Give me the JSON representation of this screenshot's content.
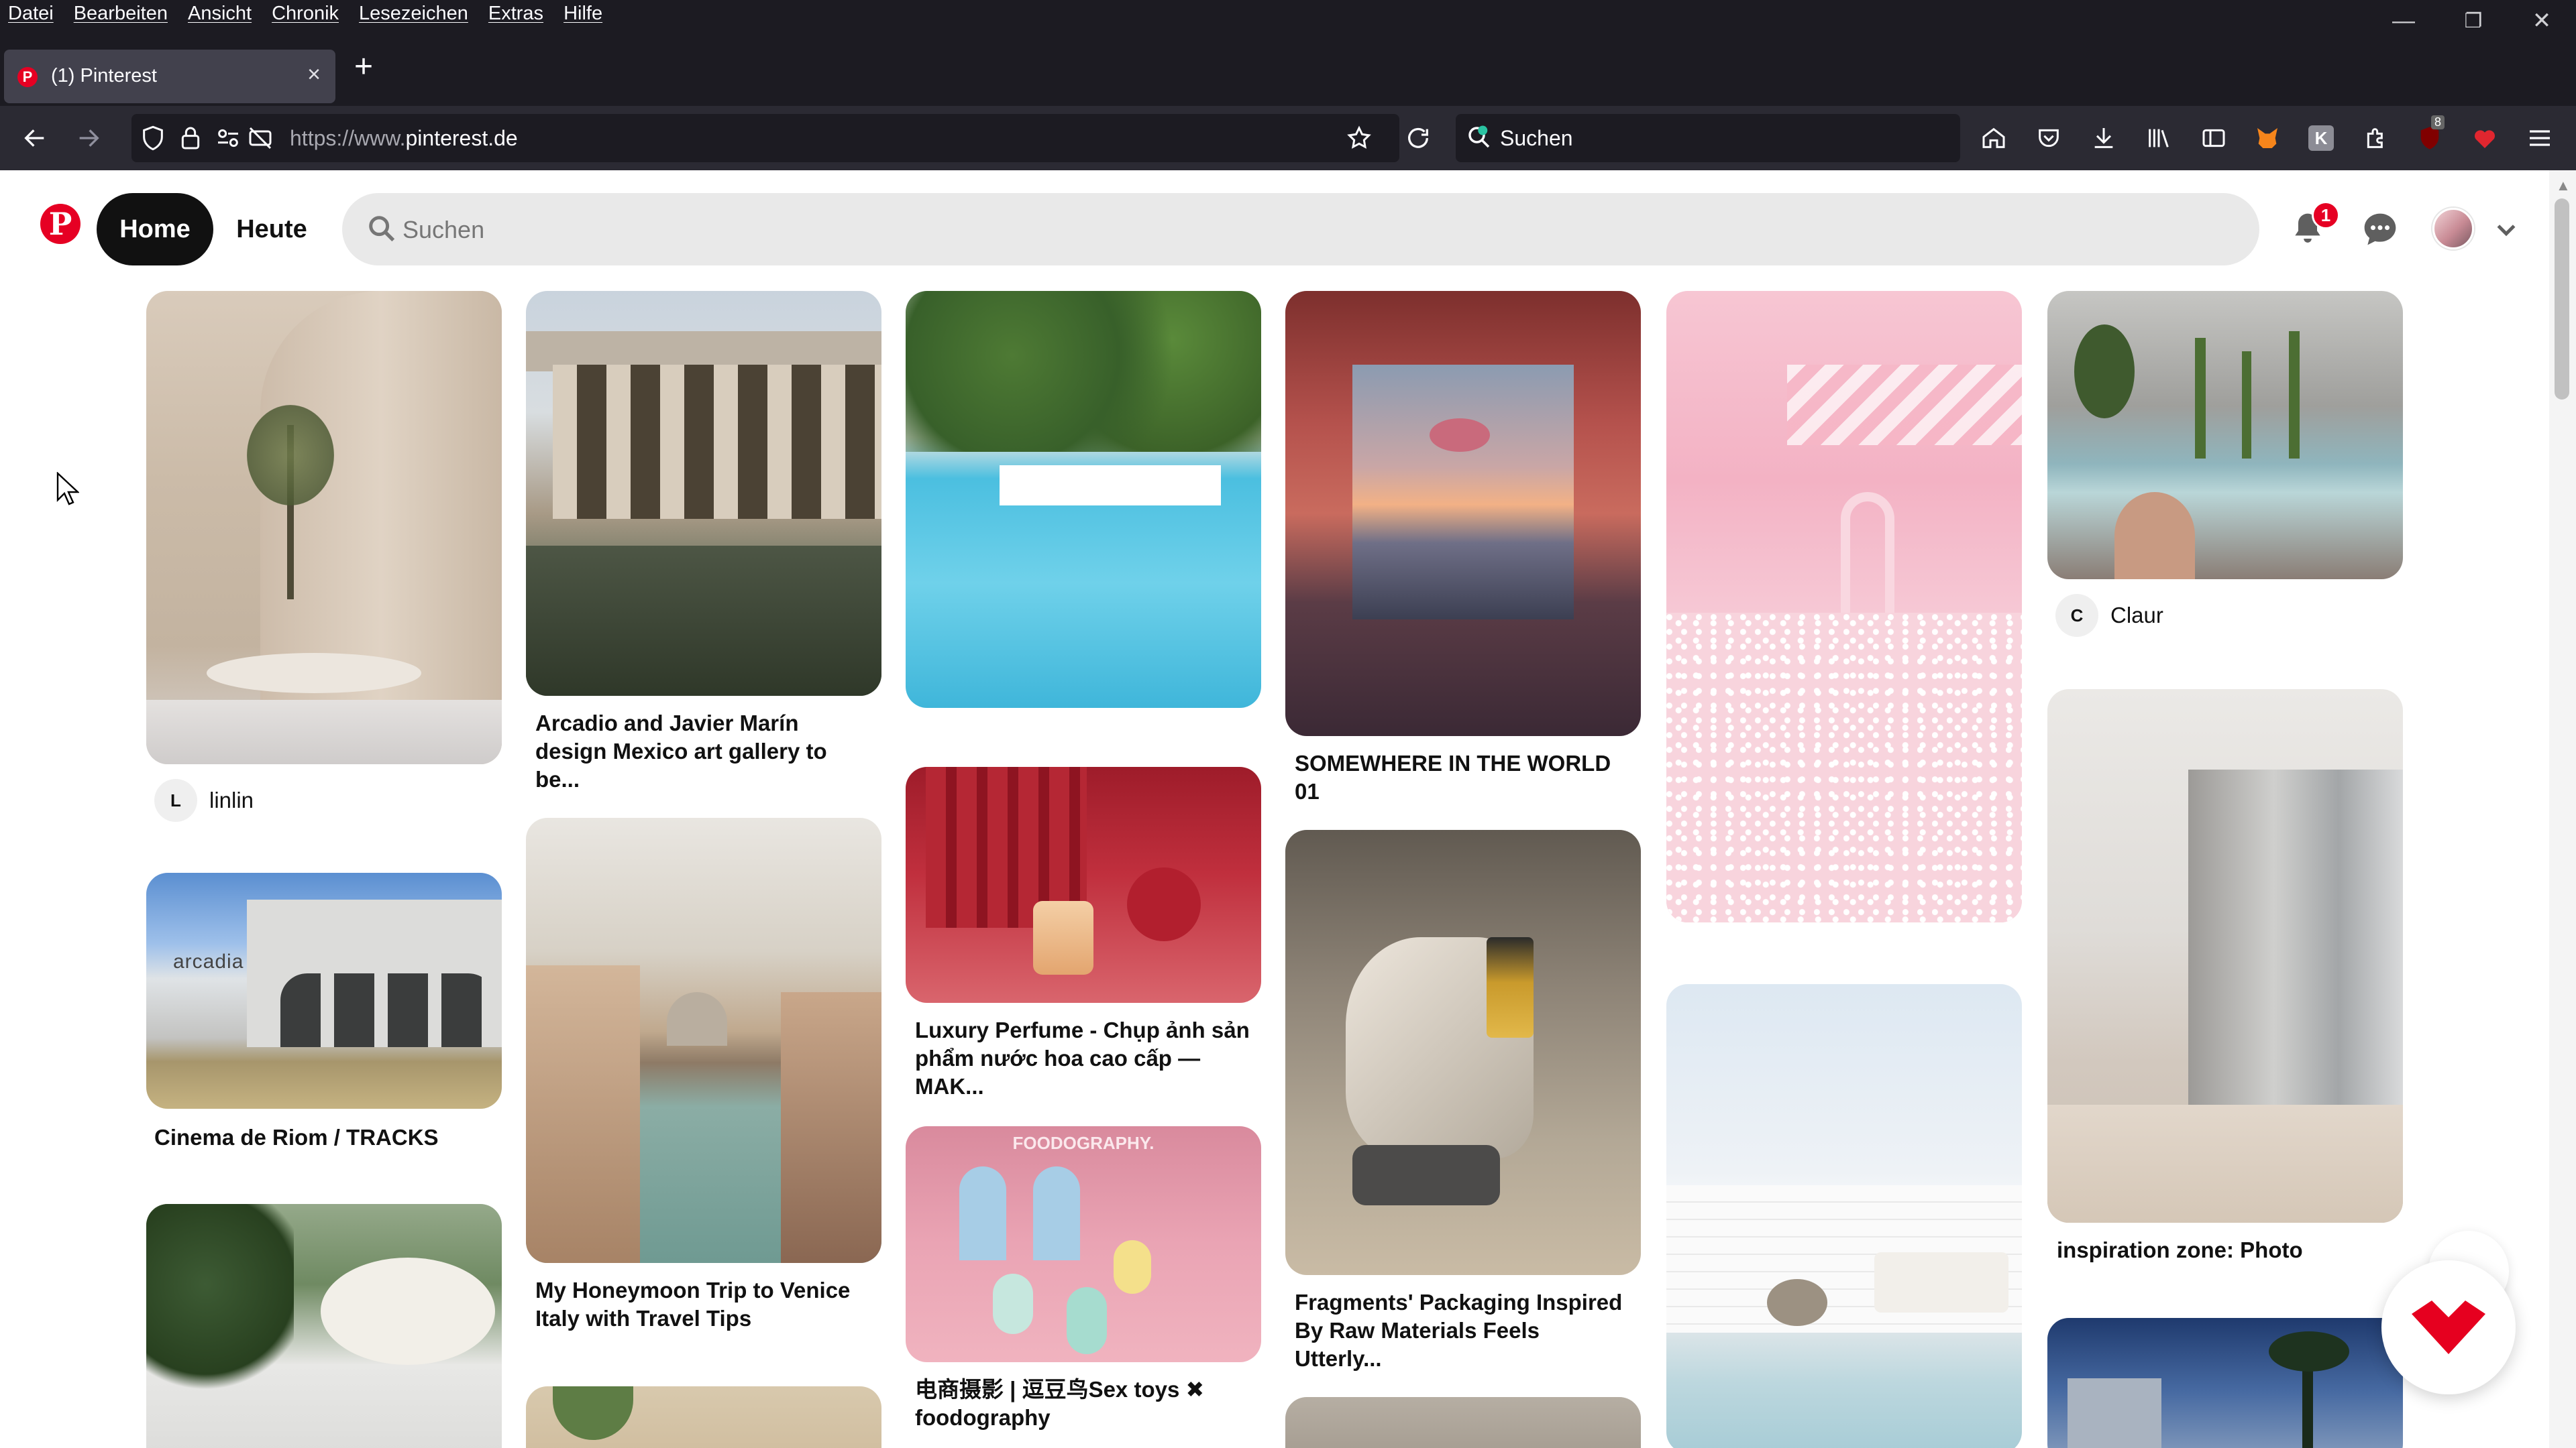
{
  "browser": {
    "menu": [
      "Datei",
      "Bearbeiten",
      "Ansicht",
      "Chronik",
      "Lesezeichen",
      "Extras",
      "Hilfe"
    ],
    "tab_title": "(1) Pinterest",
    "tab_close": "×",
    "new_tab": "+",
    "url_prefix": "https://www.",
    "url_domain": "pinterest.de",
    "search_placeholder": "Suchen",
    "extension_badge": "8",
    "win_minimize": "—",
    "win_restore": "❐",
    "win_close": "✕"
  },
  "pinterest": {
    "logo": "P",
    "nav_home": "Home",
    "nav_today": "Heute",
    "search_placeholder": "Suchen",
    "notification_count": "1",
    "brand_color": "#e60023"
  },
  "pins": [
    {
      "id": "p1",
      "caption": "",
      "author_initial": "L",
      "author": "linlin"
    },
    {
      "id": "p2",
      "caption": "Arcadio and Javier Marín design Mexico art gallery to be..."
    },
    {
      "id": "p3",
      "caption": ""
    },
    {
      "id": "p4",
      "caption": "SOMEWHERE IN THE WORLD 01"
    },
    {
      "id": "p5",
      "caption": ""
    },
    {
      "id": "p6",
      "caption": "",
      "author_initial": "C",
      "author": "Claur"
    },
    {
      "id": "p7",
      "caption": "Cinema de Riom / TRACKS",
      "image_text": "arcadia"
    },
    {
      "id": "p8",
      "caption": "My Honeymoon Trip to Venice Italy with Travel Tips"
    },
    {
      "id": "p9",
      "caption": "Luxury Perfume - Chụp ảnh sản phẩm nước hoa cao cấp — MAK..."
    },
    {
      "id": "p10",
      "caption": "Fragments' Packaging Inspired By Raw Materials Feels Utterly..."
    },
    {
      "id": "p11",
      "caption": ""
    },
    {
      "id": "p12",
      "caption": "inspiration zone: Photo"
    },
    {
      "id": "p13",
      "caption": "电商摄影 | 逗豆鸟Sex toys ✖ foodography",
      "image_text": "FOODOGRAPHY."
    }
  ]
}
